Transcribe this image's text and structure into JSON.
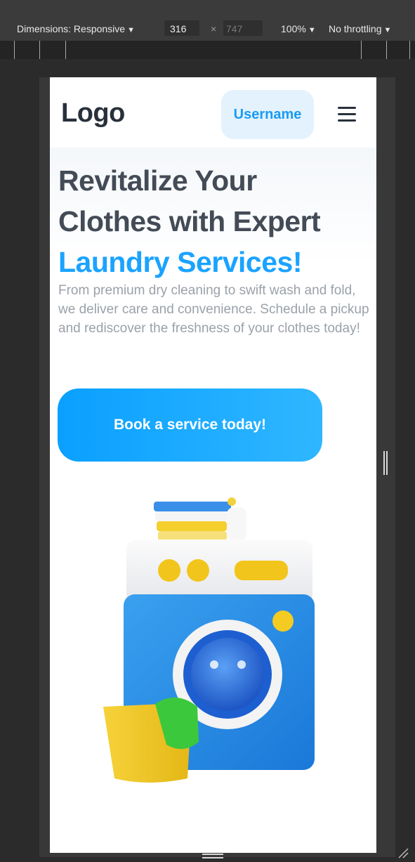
{
  "devtools": {
    "dimensions_label": "Dimensions: Responsive",
    "width_value": "316",
    "times": "×",
    "height_value": "747",
    "zoom": "100%",
    "throttling": "No throttling",
    "caret": "▼"
  },
  "page": {
    "logo": "Logo",
    "username": "Username",
    "menu_icon": "hamburger-menu-icon",
    "hero": {
      "title_line1": "Revitalize Your",
      "title_line2": "Clothes with Expert",
      "title_accent": "Laundry Services!",
      "description": "From premium dry cleaning to swift wash and fold, we deliver care and convenience. Schedule a pickup and rediscover the freshness of your clothes today!",
      "cta": "Book a service today!"
    },
    "illustration": "washing-machine-illustration"
  },
  "colors": {
    "accent": "#1aa3ff",
    "heading": "#434b56",
    "body_text": "#9aa1a9",
    "username_bg": "#e3f2fd"
  }
}
